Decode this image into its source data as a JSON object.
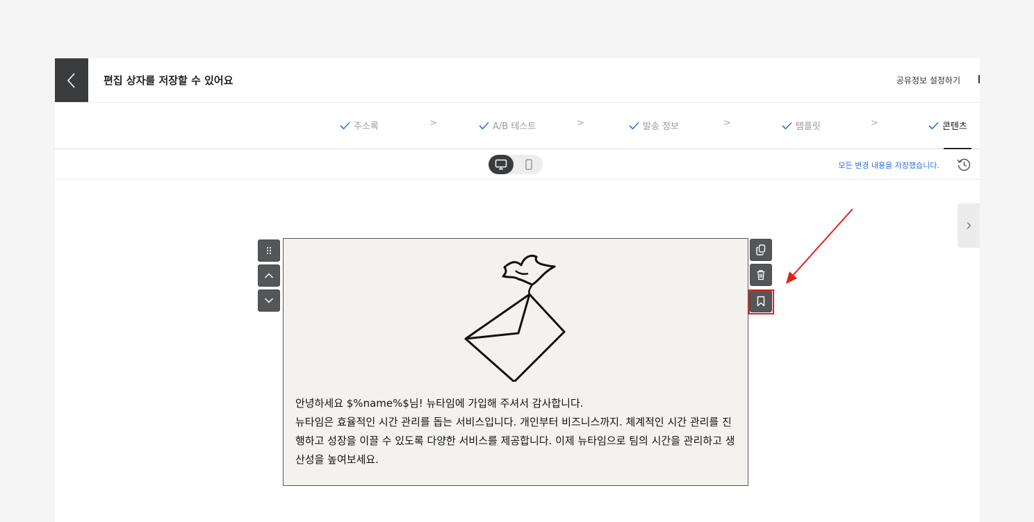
{
  "header": {
    "title": "편집 상자를 저장할 수 있어요",
    "share_label": "공유정보 설정하기"
  },
  "steps": [
    {
      "label": "주소록",
      "completed": true,
      "active": false
    },
    {
      "label": "A/B 테스트",
      "completed": true,
      "active": false
    },
    {
      "label": "발송 정보",
      "completed": true,
      "active": false
    },
    {
      "label": "템플릿",
      "completed": true,
      "active": false
    },
    {
      "label": "콘텐츠",
      "completed": true,
      "active": true
    }
  ],
  "step_separator": ">",
  "toolbar": {
    "save_status": "모든 변경 내용을 저장했습니다.",
    "selected_device": "desktop"
  },
  "block": {
    "paragraphs": [
      "안녕하세요 $%name%$님! 뉴타임에 가입해 주셔서 감사합니다.",
      "뉴타임은 효율적인 시간 관리를 돕는 서비스입니다. 개인부터 비즈니스까지. 체계적인 시간 관리를 진행하고 성장을 이끌 수 있도록 다양한 서비스를 제공합니다. 이제 뉴타임으로 팀의 시간을 관리하고 생산성을 높여보세요."
    ]
  },
  "colors": {
    "accent_blue": "#2f6fdc",
    "dark": "#3a3b3d",
    "highlight_red": "#e2211c",
    "block_bg": "#f4f2ee"
  },
  "icons": {
    "back": "chevron-left-icon",
    "desktop": "monitor-icon",
    "mobile": "phone-icon",
    "history": "history-icon",
    "drag": "drag-handle-icon",
    "move_up": "chevron-up-icon",
    "move_down": "chevron-down-icon",
    "duplicate": "copy-icon",
    "delete": "trash-icon",
    "save_block": "bookmark-icon",
    "panel": "chevron-right-icon"
  }
}
